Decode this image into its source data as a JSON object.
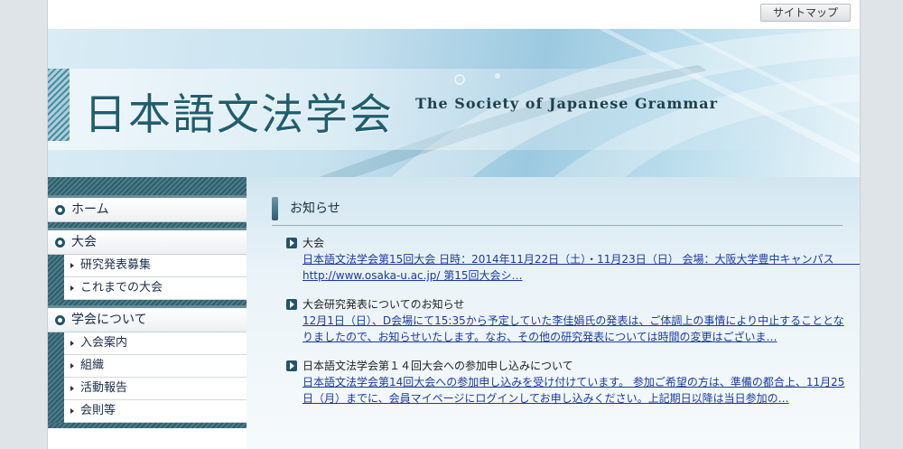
{
  "header": {
    "sitemap_label": "サイトマップ",
    "title": "日本語文法学会",
    "subtitle": "The Society of Japanese Grammar"
  },
  "sidebar": {
    "groups": [
      {
        "label": "ホーム",
        "items": []
      },
      {
        "label": "大会",
        "items": [
          "研究発表募集",
          "これまでの大会"
        ]
      },
      {
        "label": "学会について",
        "items": [
          "入会案内",
          "組織",
          "活動報告",
          "会則等"
        ]
      }
    ]
  },
  "main": {
    "section_title": "お知らせ",
    "news": [
      {
        "title": "大会",
        "body": "日本語文法学会第15回大会 日時：2014年11月22日（土）・11月23日（日） 会場：大阪大学豊中キャンパス　　　　http://www.osaka-u.ac.jp/ 第15回大会シ…"
      },
      {
        "title": "大会研究発表についてのお知らせ",
        "body": "12月1日（日）、D会場にて15:35から予定していた李佳娟氏の発表は、ご体調上の事情により中止することとなりましたので、お知らせいたします。なお、その他の研究発表については時間の変更はございま…"
      },
      {
        "title": "日本語文法学会第１４回大会への参加申し込みについて",
        "body": "日本語文法学会第14回大会への参加申し込みを受け付けています。 参加ご希望の方は、準備の都合上、11月25日（月）までに、会員マイページにログインしてお申し込みください。上記期日以降は当日参加の…"
      }
    ]
  }
}
